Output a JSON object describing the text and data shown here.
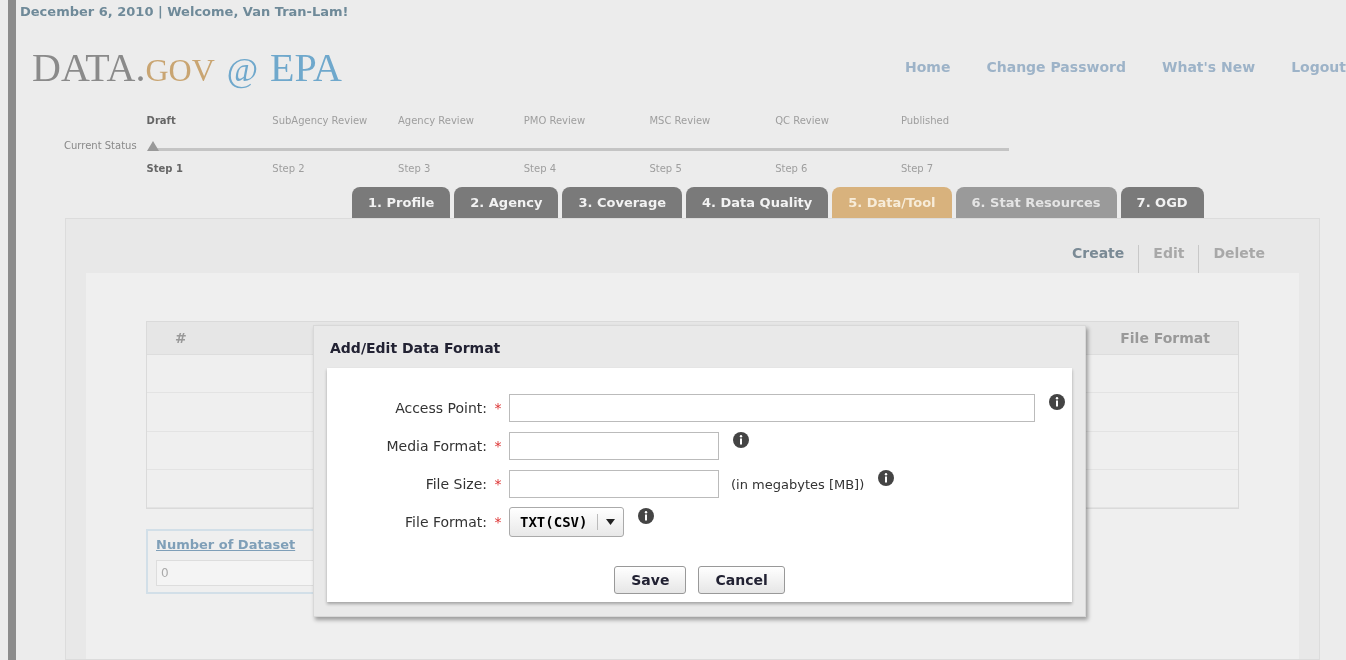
{
  "header": {
    "greeting": "December 6, 2010 | Welcome, Van Tran-Lam!",
    "logo": {
      "part_1": "DATA.",
      "part_2": "GOV",
      "part_3": "@",
      "part_4": "EPA"
    },
    "nav": [
      "Home",
      "Change Password",
      "What's New",
      "Logout"
    ]
  },
  "status": {
    "label": "Current Status",
    "stages": [
      {
        "name": "Draft",
        "step": "Step 1",
        "selected": true
      },
      {
        "name": "SubAgency Review",
        "step": "Step 2",
        "selected": false
      },
      {
        "name": "Agency Review",
        "step": "Step 3",
        "selected": false
      },
      {
        "name": "PMO Review",
        "step": "Step 4",
        "selected": false
      },
      {
        "name": "MSC Review",
        "step": "Step 5",
        "selected": false
      },
      {
        "name": "QC Review",
        "step": "Step 6",
        "selected": false
      },
      {
        "name": "Published",
        "step": "Step 7",
        "selected": false
      }
    ]
  },
  "tabs": [
    {
      "label": "1. Profile",
      "selected": false,
      "disabled": false
    },
    {
      "label": "2. Agency",
      "selected": false,
      "disabled": false
    },
    {
      "label": "3. Coverage",
      "selected": false,
      "disabled": false
    },
    {
      "label": "4. Data Quality",
      "selected": false,
      "disabled": false
    },
    {
      "label": "5. Data/Tool",
      "selected": true,
      "disabled": false
    },
    {
      "label": "6. Stat Resources",
      "selected": false,
      "disabled": true
    },
    {
      "label": "7. OGD",
      "selected": false,
      "disabled": false
    }
  ],
  "actions": [
    {
      "label": "Create",
      "disabled": false
    },
    {
      "label": "Edit",
      "disabled": true
    },
    {
      "label": "Delete",
      "disabled": true
    }
  ],
  "table": {
    "columns": [
      "#",
      "File Format"
    ]
  },
  "datasets": {
    "label": "Number of Dataset",
    "value": "0"
  },
  "dialog": {
    "title": "Add/Edit Data Format",
    "fields": [
      {
        "kind": "long-text",
        "label": "Access Point:",
        "required_mark": "*"
      },
      {
        "kind": "text",
        "label": "Media Format:",
        "required_mark": "*"
      },
      {
        "kind": "text",
        "label": "File Size:",
        "required_mark": "*",
        "hint": "(in megabytes [MB])"
      },
      {
        "kind": "select",
        "label": "File Format:",
        "required_mark": "*",
        "value": "TXT(CSV)"
      }
    ],
    "buttons": [
      "Save",
      "Cancel"
    ]
  }
}
